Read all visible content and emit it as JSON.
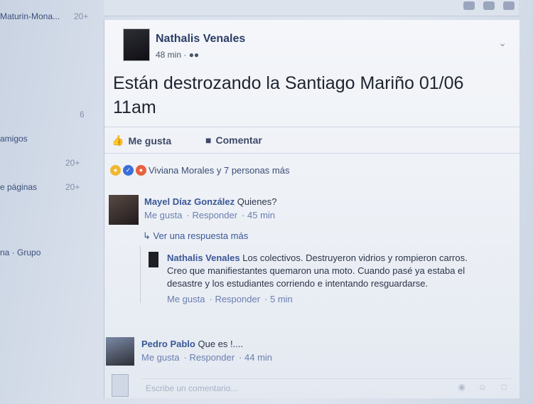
{
  "left": {
    "items": [
      {
        "label": "Maturin-Mona...",
        "count": "20+"
      },
      {
        "label": "",
        "count": "6"
      },
      {
        "label": "amigos",
        "count": ""
      },
      {
        "label": "",
        "count": "20+"
      },
      {
        "label": "e páginas",
        "count": "20+"
      },
      {
        "label": "na · Grupo",
        "count": ""
      }
    ]
  },
  "post": {
    "author": "Nathalis Venales",
    "time": "48 min · ",
    "audience_icon": "friends-icon",
    "text": "Están destrozando la Santiago Mariño 01/06 11am",
    "like_label": "Me gusta",
    "comment_label": "Comentar",
    "reactions_text": "Viviana Morales y 7 personas más"
  },
  "comments": [
    {
      "name": "Mayel Díaz González",
      "text": "Quienes?",
      "like": "Me gusta",
      "reply": "Responder",
      "time": "45 min"
    },
    {
      "name": "Pedro Pablo",
      "text": "Que es !....",
      "like": "Me gusta",
      "reply": "Responder",
      "time": "44 min"
    }
  ],
  "more_replies": "Ver una respuesta más",
  "reply": {
    "name": "Nathalis Venales",
    "text": "Los colectivos. Destruyeron vidrios y rompieron carros. Creo que manifiestantes quemaron una moto. Cuando pasé ya estaba el desastre y los estudiantes corriendo e intentando resguardarse.",
    "like": "Me gusta",
    "reply": "Responder",
    "time": "5 min"
  },
  "write_placeholder": "Escribe un comentario...",
  "colors": {
    "link": "#3a5796",
    "accent": "#3b5998"
  }
}
